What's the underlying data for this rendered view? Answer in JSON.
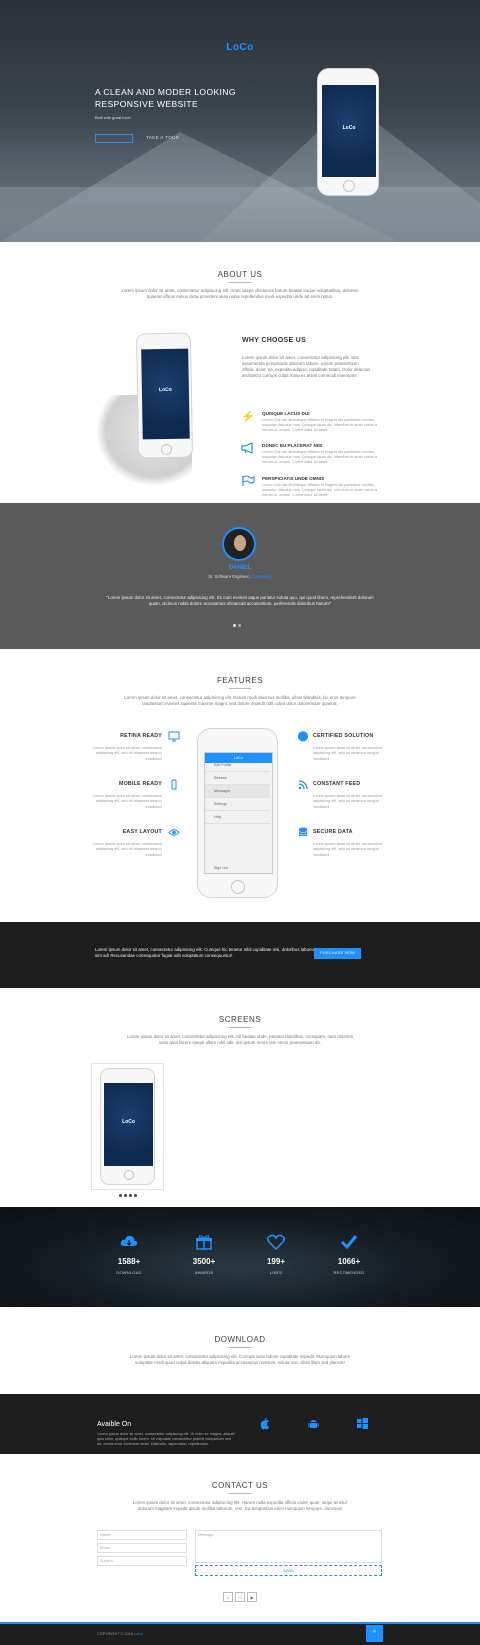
{
  "brand": {
    "logo": "LoCo",
    "accent": "#1e90ff"
  },
  "hero": {
    "title": "A CLEAN AND MODER LOOKING RESPONSIVE WEBSITE",
    "subtitle": "Built with great love!",
    "tour_label": "TAKE A TOUR",
    "phone_logo": "LoCo"
  },
  "about": {
    "heading": "ABOUT US",
    "text": "Lorem ipsum dolor sit amet, consectetur adipisicing elit. Amet saepe obcaecati harum beatae eaque voluptatibus, dolorem quaerat officiis minus dicta provident alias nobis repellendus modi expedita unde ad enim natus."
  },
  "why": {
    "title": "WHY CHOOSE US",
    "text": "Lorem ipsum dolor sit amet, consectetur adipisicing elit. Sint assumenda perspiciatis dolorum labore, earum praesentium officia, dolor, ea, expedita adipisci cupiditate totam. Dolor delectus architecto corrupti culpa maiores animi commodi inventore!",
    "phone_logo": "LoCo",
    "items": [
      {
        "icon": "lightning-icon",
        "title": "QUISQUE LACUS DUI",
        "text": "Lorem Coit nisl sit tristique efficitur et magnis dis parturient montes, nascetur ridiculus mus. Quisque lacus dui, interdum et amet varius a rutrum ut, ornare. Lorem dolor sit amet."
      },
      {
        "icon": "megaphone-icon",
        "title": "DONEC EU PLACERAT NISI",
        "text": "Lorem Coit nisl sit tristique efficitur et magnis dis parturient montes, nascetur ridiculus mus. Quisque lacus dui, interdum et amet varius a rutrum ut, ornare. Lorem dolor sit amet."
      },
      {
        "icon": "flag-icon",
        "title": "PERSPICIATIS UNDE OMNIS",
        "text": "Lorem Coit nisl sit tristique efficitur et magnis dis parturient montes, nascetur ridiculus mus. Quisque lacus dui, interdum et amet varius a rutrum ut, ornare. Lorem dolor sit amet."
      }
    ]
  },
  "testimonial": {
    "name": "DANIEL",
    "role_prefix": "Sr. Software Engineer,",
    "company": "(Company)",
    "quote": "\"Lorem ipsum dolor sit amet, consectetur adipisicing elit. Ex cum eveniet atque pariatur soluta quo, qui quod libero, reprehenderit dolorum quam, dicimus nobis dolore accusamus obcaecati accusantium, perferendis doloribus harum!\""
  },
  "features": {
    "heading": "FEATURES",
    "text": "Lorem ipsum dolor sit amet, consectetur adipisicing elit. Earum modi ducimus mollitia, ullam blanditiis, hic eros tempore laudantium eveniet sapiente maxime magni, sed dolore impedit odit culpa dolor doloremque quaerat.",
    "left": [
      {
        "icon": "monitor-icon",
        "title": "RETINA READY",
        "text": "Lorem ipsum dolor sit amet, consectetur adipiscing elit, sed do eiusmod tempor incididunt"
      },
      {
        "icon": "mobile-icon",
        "title": "MOBILE READY",
        "text": "Lorem ipsum dolor sit amet, consectetur adipiscing elit, sed do eiusmod tempor incididunt"
      },
      {
        "icon": "eye-icon",
        "title": "EASY LAYOUT",
        "text": "Lorem ipsum dolor sit amet, consectetur adipiscing elit, sed do eiusmod tempor incididunt"
      }
    ],
    "right": [
      {
        "icon": "badge-icon",
        "title": "CERTIFIED SOLUTION",
        "text": "Lorem ipsum dolor sit amet, consectetur adipiscing elit, sed do eiusmod tempor incididunt"
      },
      {
        "icon": "rss-icon",
        "title": "CONSTANT FEED",
        "text": "Lorem ipsum dolor sit amet, consectetur adipiscing elit, sed do eiusmod tempor incididunt"
      },
      {
        "icon": "database-icon",
        "title": "SECURE DATA",
        "text": "Lorem ipsum dolor sit amet, consectetur adipiscing elit, sed do eiusmod tempor incididunt"
      }
    ],
    "phone_header": "LoCo",
    "phone_menu": [
      "Edit Profile",
      "Refresh",
      "Messages",
      "Settings",
      "Help",
      "Sign Out"
    ]
  },
  "cta": {
    "text": "Lorem ipsum dolor sit amet, consectetur adipisicing elit. Cumque hic tenetur nihil cupiditate nisi, doloribus laboriosam, sint ad! Recusandae consequatur fugiat odit voluptatum consequuntur!",
    "button": "PURCHASE NOW"
  },
  "screens": {
    "heading": "SCREENS",
    "text": "Lorem ipsum dolor sit amet, consectetur adipisicing elit. Ab beatae unde, pariatur doloribus, numquam, nam dolorem iusto quia facere saepe ullam nihil odit, nisi ipsum rerum iste nemo praesentium ab.",
    "phone_logo": "LoCo"
  },
  "stats": [
    {
      "icon": "cloud-download-icon",
      "value": "1588+",
      "label": "DOWNLOAD"
    },
    {
      "icon": "gift-icon",
      "value": "3500+",
      "label": "AWARDS"
    },
    {
      "icon": "heart-icon",
      "value": "199+",
      "label": "LIKES"
    },
    {
      "icon": "check-icon",
      "value": "1066+",
      "label": "RECOMENDED"
    }
  ],
  "download": {
    "heading": "DOWNLOAD",
    "text": "Lorem ipsum dolor sit amet, consectetur adipisicing elit. Corrupti iusto labore cupiditate impedit. Numquam labore voluptate modi quod culpa debitis aliquam expedita accusamus nostrum, soluta non, dicta illum sed placeat!"
  },
  "available": {
    "title": "Avaible On",
    "text": "Lorem ipsum dolor sit amet, consectetur adipiscing elit. Ut enim ex magna, aliquet quis enim, quisque sollic lorem. Ut vulputate consectetur potenti voluptatum sed ad, omnis error inventore amet. Distinctio, aspernatur, repellendus."
  },
  "contact": {
    "heading": "CONTACT US",
    "text": "Lorem ipsum dolor sit amet, consectetur adipisicing elit. Harum nulla expedita officia under quae; sequi tenetur dolorum magnam impedit ipsum mollitia laborum, rem. Ea temporibus enim numquam tempore, ducimus!",
    "name_ph": "Name",
    "email_ph": "Email",
    "subject_ph": "Subject",
    "message_ph": "Message",
    "send": "SEND",
    "social": [
      "f",
      "t",
      "▶"
    ]
  },
  "footer": {
    "prefix": "COPYRIGHT © 2016 ",
    "brand": "LoCo",
    "to_top": "^"
  }
}
